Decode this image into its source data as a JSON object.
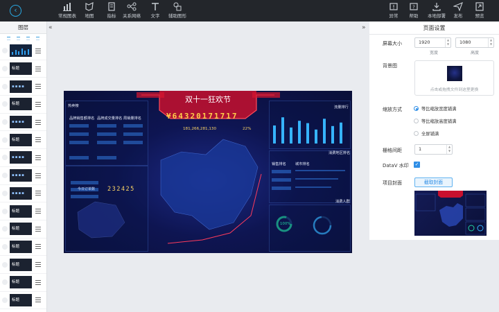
{
  "toolbar": {
    "left_tools": [
      {
        "label": "常规图表",
        "icon": "bar-chart-icon"
      },
      {
        "label": "地图",
        "icon": "map-icon"
      },
      {
        "label": "指标",
        "icon": "indicator-icon"
      },
      {
        "label": "关系网络",
        "icon": "network-icon"
      },
      {
        "label": "文字",
        "icon": "text-icon"
      },
      {
        "label": "辅助图形",
        "icon": "shapes-icon"
      }
    ],
    "right_tools": [
      {
        "label": "异常",
        "icon": "warning-icon"
      },
      {
        "label": "帮助",
        "icon": "help-icon"
      },
      {
        "label": "本地部署",
        "icon": "download-icon"
      },
      {
        "label": "发布",
        "icon": "send-icon"
      },
      {
        "label": "预览",
        "icon": "preview-icon"
      }
    ]
  },
  "layers": {
    "title": "图层",
    "items": [
      {
        "label": "",
        "kind": "bars"
      },
      {
        "label": "标题",
        "kind": "text"
      },
      {
        "label": "",
        "kind": "nums"
      },
      {
        "label": "标题",
        "kind": "text"
      },
      {
        "label": "",
        "kind": "nums"
      },
      {
        "label": "标题",
        "kind": "text"
      },
      {
        "label": "",
        "kind": "nums"
      },
      {
        "label": "",
        "kind": "nums"
      },
      {
        "label": "",
        "kind": "nums"
      },
      {
        "label": "标题",
        "kind": "text"
      },
      {
        "label": "标题",
        "kind": "text"
      },
      {
        "label": "标题",
        "kind": "text"
      },
      {
        "label": "标题",
        "kind": "text"
      },
      {
        "label": "标题",
        "kind": "text"
      },
      {
        "label": "标题",
        "kind": "text"
      },
      {
        "label": "标题",
        "kind": "text"
      }
    ]
  },
  "settings": {
    "title": "页面设置",
    "screen_size_label": "屏幕大小",
    "width_value": "1920",
    "height_value": "1080",
    "width_caption": "宽度",
    "height_caption": "高度",
    "background_label": "背景图",
    "background_hint": "点击或拖拽文件到这里更换",
    "scale_label": "缩放方式",
    "scale_options": [
      "等比缩放宽度铺满",
      "等比缩放高度铺满",
      "全屏铺满"
    ],
    "scale_selected": 0,
    "grid_label": "栅格间距",
    "grid_value": "1",
    "watermark_label": "DataV 水印",
    "watermark_checked": true,
    "cover_label": "项目封面",
    "cover_button": "截取封面"
  },
  "dashboard": {
    "title": "双十一狂欢节",
    "total": "¥64320171717",
    "sub_total": "181,266,281,130",
    "sub_rate": "22%",
    "today_label": "今日订单数",
    "today_value": "232425",
    "rate_ring": "100%",
    "panel_titles": [
      "热卖榜",
      "品牌销售额排名",
      "品牌成交量排名",
      "周销量排名",
      "流量排行",
      "消费地区排名",
      "销售排名",
      "城市排名",
      "消费人群"
    ]
  },
  "colors": {
    "toolbar_bg": "#23262b",
    "accent": "#2f8ee6",
    "dash_bg": "#0e1552",
    "dash_title_red": "#e11d3a",
    "dash_gold": "#ffcf4a"
  }
}
